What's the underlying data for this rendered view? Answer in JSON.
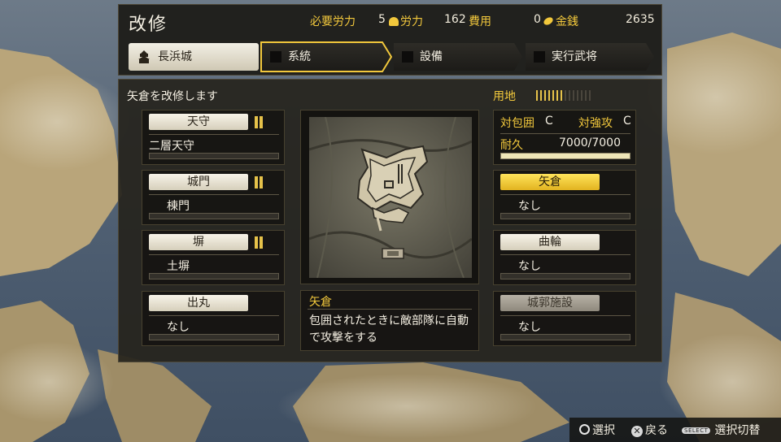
{
  "header": {
    "title": "改修",
    "required_labor_label": "必要労力",
    "required_labor_value": "5",
    "labor_label": "労力",
    "labor_value": "162",
    "cost_label": "費用",
    "cost_value": "0",
    "money_label": "金銭",
    "money_value": "2635"
  },
  "tabs": {
    "castle": "長浜城",
    "items": [
      {
        "label": "系統",
        "selected": true
      },
      {
        "label": "設備",
        "selected": false
      },
      {
        "label": "実行武将",
        "selected": false
      }
    ]
  },
  "main": {
    "description": "矢倉を改修します",
    "land_label": "用地",
    "land_filled": 7,
    "land_total": 14
  },
  "left_slots": [
    {
      "button": "天守",
      "value": "二層天守",
      "level": 2,
      "style": "white"
    },
    {
      "button": "城門",
      "value": "棟門",
      "level": 2,
      "style": "white"
    },
    {
      "button": "塀",
      "value": "土塀",
      "level": 2,
      "style": "white"
    },
    {
      "button": "出丸",
      "value": "なし",
      "level": 0,
      "style": "white"
    }
  ],
  "defense": {
    "siege_label": "対包囲",
    "siege_value": "C",
    "assault_label": "対強攻",
    "assault_value": "C",
    "durability_label": "耐久",
    "durability_value": "7000/7000",
    "durability_fraction": 1.0
  },
  "right_slots": [
    {
      "button": "矢倉",
      "value": "なし",
      "style": "yellow"
    },
    {
      "button": "曲輪",
      "value": "なし",
      "style": "white"
    },
    {
      "button": "城郭施設",
      "value": "なし",
      "style": "gray"
    }
  ],
  "info": {
    "title": "矢倉",
    "text": "包囲されたときに敵部隊に自動で攻撃をする"
  },
  "footer": {
    "confirm": "選択",
    "back": "戻る",
    "select_badge": "SELECT",
    "switch": "選択切替"
  },
  "colors": {
    "accent_gold": "#f2c83c",
    "panel_bg": "#26231d",
    "selected_yellow": "#ffe45a"
  }
}
